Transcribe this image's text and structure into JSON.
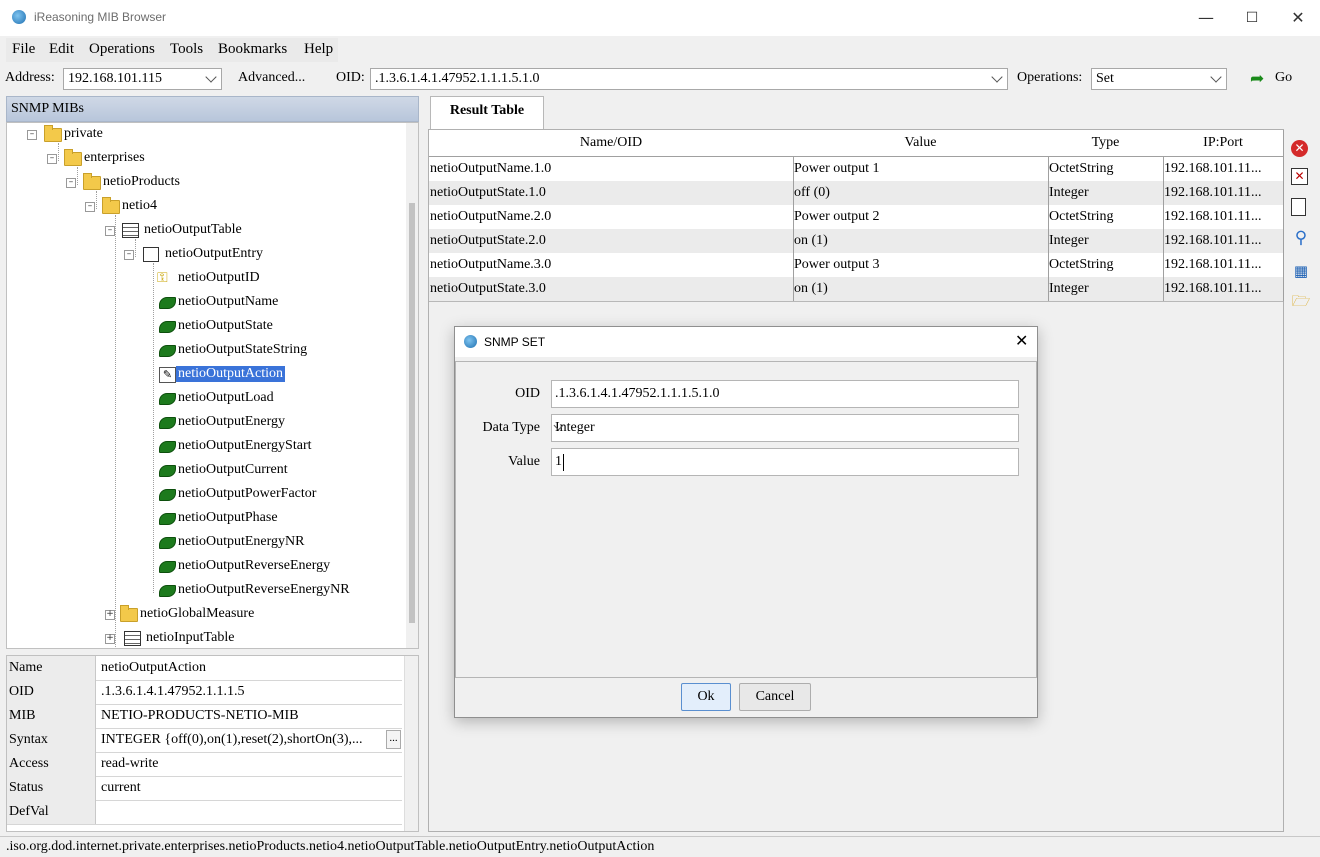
{
  "window": {
    "title": "iReasoning MIB Browser"
  },
  "menu": [
    "File",
    "Edit",
    "Operations",
    "Tools",
    "Bookmarks",
    "Help"
  ],
  "toolbar": {
    "address_label": "Address:",
    "address_value": "192.168.101.115",
    "advanced_label": "Advanced...",
    "oid_label": "OID:",
    "oid_value": ".1.3.6.1.4.1.47952.1.1.1.5.1.0",
    "operations_label": "Operations:",
    "operations_value": "Set",
    "go_label": "Go"
  },
  "mib_panel": {
    "header": "SNMP MIBs",
    "tree": [
      {
        "label": "private",
        "icon": "folder-icon"
      },
      {
        "label": "enterprises",
        "icon": "folder-icon"
      },
      {
        "label": "netioProducts",
        "icon": "folder-icon"
      },
      {
        "label": "netio4",
        "icon": "folder-icon"
      },
      {
        "label": "netioOutputTable",
        "icon": "table-icon"
      },
      {
        "label": "netioOutputEntry",
        "icon": "entry-icon"
      },
      {
        "label": "netioOutputID",
        "icon": "key-icon"
      },
      {
        "label": "netioOutputName",
        "icon": "leaf-icon"
      },
      {
        "label": "netioOutputState",
        "icon": "leaf-icon"
      },
      {
        "label": "netioOutputStateString",
        "icon": "leaf-icon"
      },
      {
        "label": "netioOutputAction",
        "icon": "writable-leaf-icon"
      },
      {
        "label": "netioOutputLoad",
        "icon": "leaf-icon"
      },
      {
        "label": "netioOutputEnergy",
        "icon": "leaf-icon"
      },
      {
        "label": "netioOutputEnergyStart",
        "icon": "leaf-icon"
      },
      {
        "label": "netioOutputCurrent",
        "icon": "leaf-icon"
      },
      {
        "label": "netioOutputPowerFactor",
        "icon": "leaf-icon"
      },
      {
        "label": "netioOutputPhase",
        "icon": "leaf-icon"
      },
      {
        "label": "netioOutputEnergyNR",
        "icon": "leaf-icon"
      },
      {
        "label": "netioOutputReverseEnergy",
        "icon": "leaf-icon"
      },
      {
        "label": "netioOutputReverseEnergyNR",
        "icon": "leaf-icon"
      },
      {
        "label": "netioGlobalMeasure",
        "icon": "folder-icon"
      },
      {
        "label": "netioInputTable",
        "icon": "table-icon"
      }
    ],
    "selected": "netioOutputAction"
  },
  "properties": [
    {
      "key": "Name",
      "value": "netioOutputAction"
    },
    {
      "key": "OID",
      "value": ".1.3.6.1.4.1.47952.1.1.1.5"
    },
    {
      "key": "MIB",
      "value": "NETIO-PRODUCTS-NETIO-MIB"
    },
    {
      "key": "Syntax",
      "value": "INTEGER {off(0),on(1),reset(2),shortOn(3),..."
    },
    {
      "key": "Access",
      "value": "read-write"
    },
    {
      "key": "Status",
      "value": "current"
    },
    {
      "key": "DefVal",
      "value": ""
    }
  ],
  "result": {
    "tab": "Result Table",
    "columns": [
      "Name/OID",
      "Value",
      "Type",
      "IP:Port"
    ],
    "rows": [
      [
        "netioOutputName.1.0",
        "Power output 1",
        "OctetString",
        "192.168.101.11..."
      ],
      [
        "netioOutputState.1.0",
        "off (0)",
        "Integer",
        "192.168.101.11..."
      ],
      [
        "netioOutputName.2.0",
        "Power output 2",
        "OctetString",
        "192.168.101.11..."
      ],
      [
        "netioOutputState.2.0",
        "on (1)",
        "Integer",
        "192.168.101.11..."
      ],
      [
        "netioOutputName.3.0",
        "Power output 3",
        "OctetString",
        "192.168.101.11..."
      ],
      [
        "netioOutputState.3.0",
        "on (1)",
        "Integer",
        "192.168.101.11..."
      ]
    ]
  },
  "dialog": {
    "title": "SNMP SET",
    "oid_label": "OID",
    "oid_value": ".1.3.6.1.4.1.47952.1.1.1.5.1.0",
    "type_label": "Data Type",
    "type_value": "Integer",
    "value_label": "Value",
    "value_value": "1",
    "ok_label": "Ok",
    "cancel_label": "Cancel"
  },
  "status_bar": ".iso.org.dod.internet.private.enterprises.netioProducts.netio4.netioOutputTable.netioOutputEntry.netioOutputAction",
  "colors": {
    "selection": "#3a73d9",
    "header_gradient": "#c3cfe0",
    "leaf": "#1d7a1d",
    "folder": "#f3c94a"
  }
}
